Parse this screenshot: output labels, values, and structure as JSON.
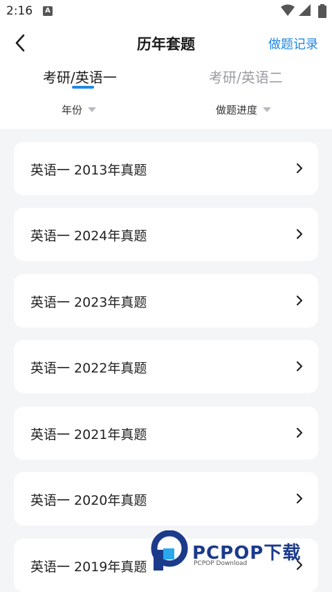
{
  "status_bar": {
    "time": "2:16",
    "notification_icon": "a-badge-icon",
    "icons": [
      "wifi-icon",
      "signal-icon",
      "battery-icon"
    ]
  },
  "header": {
    "back_icon": "chevron-left-icon",
    "title": "历年套题",
    "record_link": "做题记录"
  },
  "tabs": [
    {
      "label": "考研/英语一",
      "active": true
    },
    {
      "label": "考研/英语二",
      "active": false
    }
  ],
  "filters": {
    "year": "年份",
    "progress": "做题进度"
  },
  "papers": [
    {
      "label": "英语一 2013年真题"
    },
    {
      "label": "英语一 2024年真题"
    },
    {
      "label": "英语一 2023年真题"
    },
    {
      "label": "英语一 2022年真题"
    },
    {
      "label": "英语一 2021年真题"
    },
    {
      "label": "英语一 2020年真题"
    },
    {
      "label": "英语一 2019年真题"
    }
  ],
  "watermark": {
    "title": "PCPOP下载",
    "subtitle": "PCPOP Download"
  },
  "colors": {
    "accent": "#1f87e5",
    "background": "#f4f5f7",
    "inactive_tab": "#9a9ca3"
  }
}
